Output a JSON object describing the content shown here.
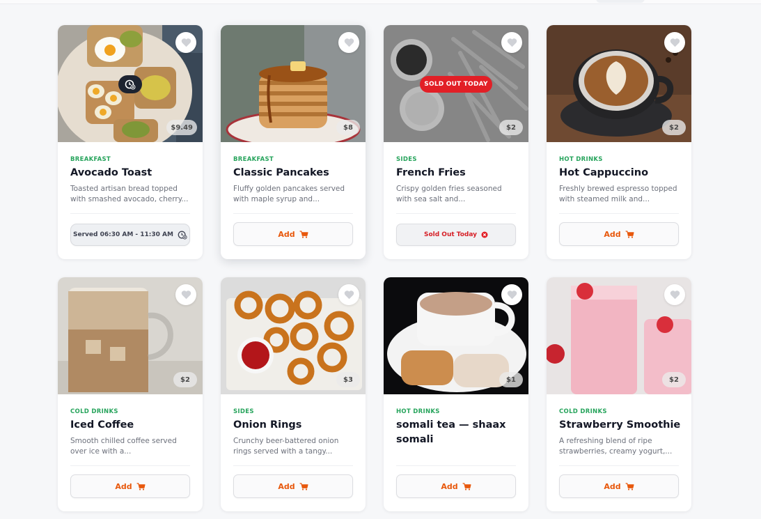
{
  "colors": {
    "category": "#27a45c",
    "add_button_text": "#e8580c",
    "sold_out": "#e21f26",
    "card_bg": "#ffffff",
    "page_bg": "#f6f7f9"
  },
  "items": [
    {
      "category": "BREAKFAST",
      "name": "Avocado Toast",
      "desc_line1": "Toasted artisan bread topped",
      "desc_line2": "with smashed avocado, cherry...",
      "price": "$9.49",
      "badge": "clock-x-icon",
      "action": {
        "type": "served",
        "label": "Served 06:30 AM - 11:30 AM",
        "icon": "clock-x-icon"
      }
    },
    {
      "category": "BREAKFAST",
      "name": "Classic Pancakes",
      "desc_line1": "Fluffy golden pancakes served",
      "desc_line2": "with maple syrup and...",
      "price": "$8",
      "action": {
        "type": "add",
        "label": "Add",
        "icon": "cart-icon"
      }
    },
    {
      "category": "SIDES",
      "name": "French Fries",
      "desc_line1": "Crispy golden fries seasoned",
      "desc_line2": "with sea salt and...",
      "price": "$2",
      "sold_out_badge": "SOLD OUT TODAY",
      "action": {
        "type": "sold",
        "label": "Sold Out Today",
        "icon": "x-circle-icon"
      }
    },
    {
      "category": "HOT DRINKS",
      "name": "Hot Cappuccino",
      "desc_line1": "Freshly brewed espresso topped",
      "desc_line2": "with steamed milk and...",
      "price": "$2",
      "action": {
        "type": "add",
        "label": "Add",
        "icon": "cart-icon"
      }
    },
    {
      "category": "COLD DRINKS",
      "name": "Iced Coffee",
      "desc_line1": "Smooth chilled coffee served",
      "desc_line2": "over ice with a...",
      "price": "$2",
      "action": {
        "type": "add",
        "label": "Add",
        "icon": "cart-icon"
      }
    },
    {
      "category": "SIDES",
      "name": "Onion Rings",
      "desc_line1": "Crunchy beer-battered onion",
      "desc_line2": "rings served with a tangy...",
      "price": "$3",
      "action": {
        "type": "add",
        "label": "Add",
        "icon": "cart-icon"
      }
    },
    {
      "category": "HOT DRINKS",
      "name": "somali tea — shaax somali",
      "desc_line1": "",
      "desc_line2": "",
      "price": "$1",
      "action": {
        "type": "add",
        "label": "Add",
        "icon": "cart-icon"
      }
    },
    {
      "category": "COLD DRINKS",
      "name": "Strawberry Smoothie",
      "desc_line1": "A refreshing blend of ripe",
      "desc_line2": "strawberries, creamy yogurt,...",
      "price": "$2",
      "action": {
        "type": "add",
        "label": "Add",
        "icon": "cart-icon"
      }
    }
  ]
}
